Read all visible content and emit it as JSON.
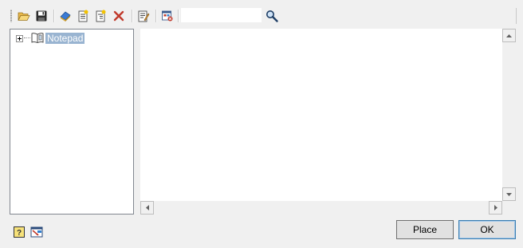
{
  "toolbar": {
    "buttons": [
      {
        "name": "open-folder-icon"
      },
      {
        "name": "save-icon"
      },
      {
        "name": "catalog-icon"
      },
      {
        "name": "new-page-icon"
      },
      {
        "name": "new-subpage-icon"
      },
      {
        "name": "delete-icon"
      },
      {
        "name": "properties-icon"
      },
      {
        "name": "insert-object-icon"
      }
    ],
    "search": {
      "value": "",
      "placeholder": ""
    },
    "search_icon": "search-icon"
  },
  "tree": {
    "items": [
      {
        "label": "Notepad",
        "icon": "notepad-book-icon",
        "expanded": false,
        "selected": true
      }
    ]
  },
  "footer": {
    "left_icons": [
      "help-icon",
      "screen-capture-icon"
    ],
    "place_label": "Place",
    "ok_label": "OK"
  },
  "colors": {
    "selection": "#99b4d1",
    "window_bg": "#f0f0f0",
    "delete_red": "#c0392b"
  }
}
